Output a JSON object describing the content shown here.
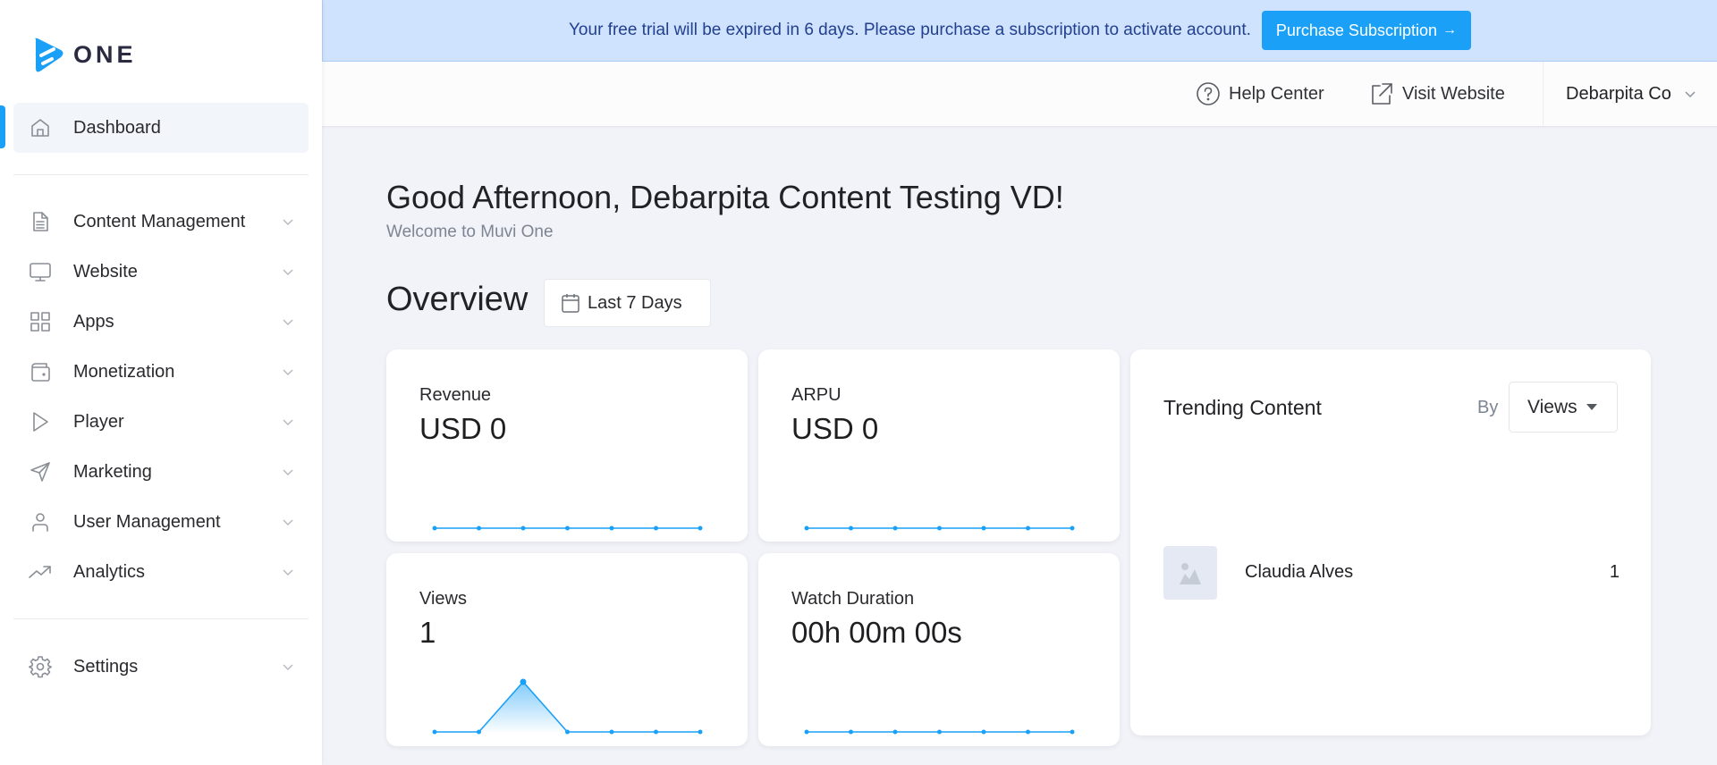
{
  "app": {
    "logo_text": "ONE",
    "brand_color": "#1aa0f7"
  },
  "sidebar": {
    "items": [
      {
        "label": "Dashboard",
        "icon": "home-icon",
        "active": true
      },
      {
        "label": "Content Management",
        "icon": "document-icon",
        "expandable": true
      },
      {
        "label": "Website",
        "icon": "monitor-icon",
        "expandable": true
      },
      {
        "label": "Apps",
        "icon": "grid-icon",
        "expandable": true
      },
      {
        "label": "Monetization",
        "icon": "wallet-icon",
        "expandable": true
      },
      {
        "label": "Player",
        "icon": "play-icon",
        "expandable": true
      },
      {
        "label": "Marketing",
        "icon": "send-icon",
        "expandable": true
      },
      {
        "label": "User Management",
        "icon": "user-icon",
        "expandable": true
      },
      {
        "label": "Analytics",
        "icon": "trending-up-icon",
        "expandable": true
      },
      {
        "label": "Settings",
        "icon": "gear-icon",
        "expandable": true
      }
    ]
  },
  "banner": {
    "message": "Your free trial will be expired in 6 days. Please purchase a subscription to activate account.",
    "button_label": "Purchase Subscription",
    "button_arrow": "→",
    "background_color": "#cfe2fe"
  },
  "topbar": {
    "help_label": "Help Center",
    "visit_label": "Visit Website",
    "account_name": "Debarpita Co"
  },
  "main": {
    "greeting": "Good Afternoon, Debarpita Content Testing VD!",
    "welcome": "Welcome to Muvi One",
    "overview_title": "Overview",
    "date_range": "Last 7 Days"
  },
  "cards": [
    {
      "label": "Revenue",
      "value": "USD 0"
    },
    {
      "label": "ARPU",
      "value": "USD 0"
    },
    {
      "label": "Views",
      "value": "1"
    },
    {
      "label": "Watch Duration",
      "value": "00h 00m 00s"
    }
  ],
  "trending": {
    "title": "Trending Content",
    "by_label": "By",
    "sort_selected": "Views",
    "items": [
      {
        "name": "Claudia Alves",
        "count": "1"
      }
    ]
  },
  "chart_data": [
    {
      "type": "line",
      "title": "Revenue",
      "x": [
        1,
        2,
        3,
        4,
        5,
        6,
        7
      ],
      "values": [
        0,
        0,
        0,
        0,
        0,
        0,
        0
      ],
      "ylim": [
        0,
        1
      ],
      "grid": false
    },
    {
      "type": "line",
      "title": "ARPU",
      "x": [
        1,
        2,
        3,
        4,
        5,
        6,
        7
      ],
      "values": [
        0,
        0,
        0,
        0,
        0,
        0,
        0
      ],
      "ylim": [
        0,
        1
      ],
      "grid": false
    },
    {
      "type": "area",
      "title": "Views",
      "x": [
        1,
        2,
        3,
        4,
        5,
        6,
        7
      ],
      "values": [
        0,
        0,
        1,
        0,
        0,
        0,
        0
      ],
      "ylim": [
        0,
        1
      ],
      "grid": false
    },
    {
      "type": "line",
      "title": "Watch Duration",
      "x": [
        1,
        2,
        3,
        4,
        5,
        6,
        7
      ],
      "values": [
        0,
        0,
        0,
        0,
        0,
        0,
        0
      ],
      "ylim": [
        0,
        1
      ],
      "grid": false
    }
  ]
}
